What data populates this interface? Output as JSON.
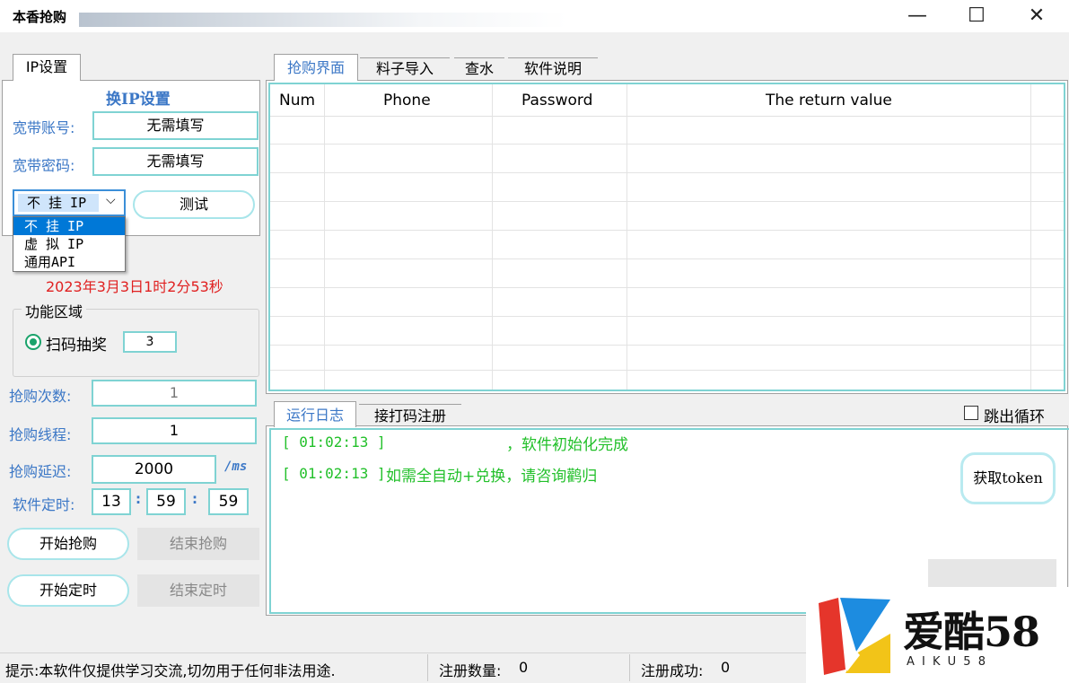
{
  "window": {
    "title": "本香抢购",
    "min_glyph": "—",
    "max_glyph": "☐",
    "close_glyph": "✕"
  },
  "left": {
    "tab": "IP设置",
    "section_title": "换IP设置",
    "account_label": "宽带账号:",
    "account_value": "无需填写",
    "password_label": "宽带密码:",
    "password_value": "无需填写",
    "ip_select": {
      "selected": "不 挂 IP",
      "options": [
        "不 挂 IP",
        "虚 拟 IP",
        "通用API"
      ]
    },
    "test_button": "测试",
    "expiry": "2023年3月3日1时2分53秒",
    "func_group": "功能区域",
    "radio_label": "扫码抽奖",
    "radio_value": "3",
    "count_label": "抢购次数:",
    "count_value": "1",
    "thread_label": "抢购线程:",
    "thread_value": "1",
    "delay_label": "抢购延迟:",
    "delay_value": "2000",
    "delay_unit": "/ms",
    "timer_label": "软件定时:",
    "timer_h": "13",
    "timer_m": "59",
    "timer_s": "59",
    "sep": ":",
    "start_buy": "开始抢购",
    "end_buy": "结束抢购",
    "start_timer": "开始定时",
    "end_timer": "结束定时"
  },
  "right": {
    "tabs": [
      "抢购界面",
      "料子导入",
      "查水",
      "软件说明"
    ],
    "table": {
      "headers": [
        "Num",
        "Phone",
        "Password",
        "The return value"
      ],
      "rows": []
    },
    "log_tabs": [
      "运行日志",
      "接打码注册"
    ],
    "loop_checkbox": "跳出循环",
    "log_lines": [
      {
        "time": "[ 01:02:13 ]",
        "text": "，软件初始化完成"
      },
      {
        "time": "[ 01:02:13 ]",
        "text": "如需全自动+兑换，请咨询鹳归"
      }
    ],
    "token_button": "获取token"
  },
  "status": {
    "tip": "提示:本软件仅提供学习交流,切勿用于任何非法用途.",
    "reg_count_label": "注册数量:",
    "reg_count": "0",
    "reg_success_label": "注册成功:",
    "reg_success": "0"
  },
  "watermark": {
    "text": "爱酷58",
    "sub": "A I K U 5 8"
  },
  "colors": {
    "accent_blue": "#3b77c6",
    "log_green": "#22c02a",
    "expiry_red": "#e02020",
    "border_teal": "#7fd3d3"
  }
}
